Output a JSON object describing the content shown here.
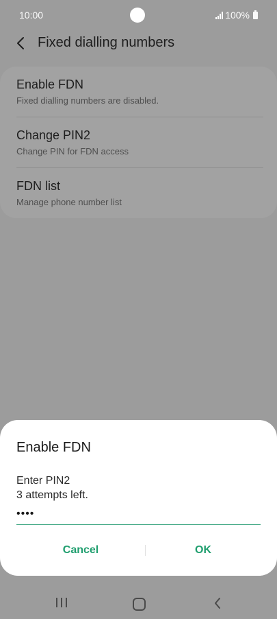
{
  "status_bar": {
    "time": "10:00",
    "battery": "100%"
  },
  "header": {
    "title": "Fixed dialling numbers",
    "back_icon": "chevron-left-icon"
  },
  "settings": {
    "items": [
      {
        "title": "Enable FDN",
        "subtitle": "Fixed dialling numbers are disabled."
      },
      {
        "title": "Change PIN2",
        "subtitle": "Change PIN for FDN access"
      },
      {
        "title": "FDN list",
        "subtitle": "Manage phone number list"
      }
    ]
  },
  "dialog": {
    "title": "Enable FDN",
    "prompt": "Enter PIN2",
    "attempts": "3 attempts left.",
    "pin_value": "••••",
    "cancel_label": "Cancel",
    "ok_label": "OK",
    "accent_color": "#1f9e6e"
  },
  "nav_bar": {
    "recent_icon": "recent-apps-icon",
    "home_icon": "home-icon",
    "back_icon": "back-icon"
  }
}
